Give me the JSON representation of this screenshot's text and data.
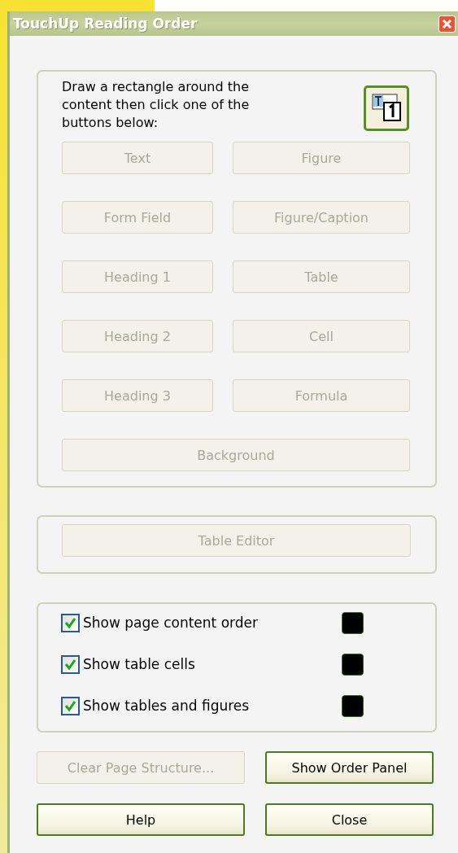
{
  "window": {
    "title": "TouchUp Reading Order"
  },
  "instructions": "Draw a rectangle around the content then click one of the buttons below:",
  "tag_buttons": [
    {
      "label": "Text",
      "disabled": true
    },
    {
      "label": "Figure",
      "disabled": true
    },
    {
      "label": "Form Field",
      "disabled": true
    },
    {
      "label": "Figure/Caption",
      "disabled": true
    },
    {
      "label": "Heading 1",
      "disabled": true
    },
    {
      "label": "Table",
      "disabled": true
    },
    {
      "label": "Heading 2",
      "disabled": true
    },
    {
      "label": "Cell",
      "disabled": true
    },
    {
      "label": "Heading 3",
      "disabled": true
    },
    {
      "label": "Formula",
      "disabled": true
    },
    {
      "label": "Background",
      "disabled": true
    }
  ],
  "table_editor": {
    "label": "Table Editor",
    "disabled": true
  },
  "options": [
    {
      "label": "Show page content order",
      "checked": true,
      "color": "#000000"
    },
    {
      "label": "Show table cells",
      "checked": true,
      "color": "#000000"
    },
    {
      "label": "Show tables and figures",
      "checked": true,
      "color": "#000000"
    }
  ],
  "buttons": [
    {
      "label": "Clear Page Structure...",
      "disabled": true
    },
    {
      "label": "Show Order Panel",
      "disabled": false
    },
    {
      "label": "Help",
      "disabled": false
    },
    {
      "label": "Close",
      "disabled": false
    }
  ]
}
